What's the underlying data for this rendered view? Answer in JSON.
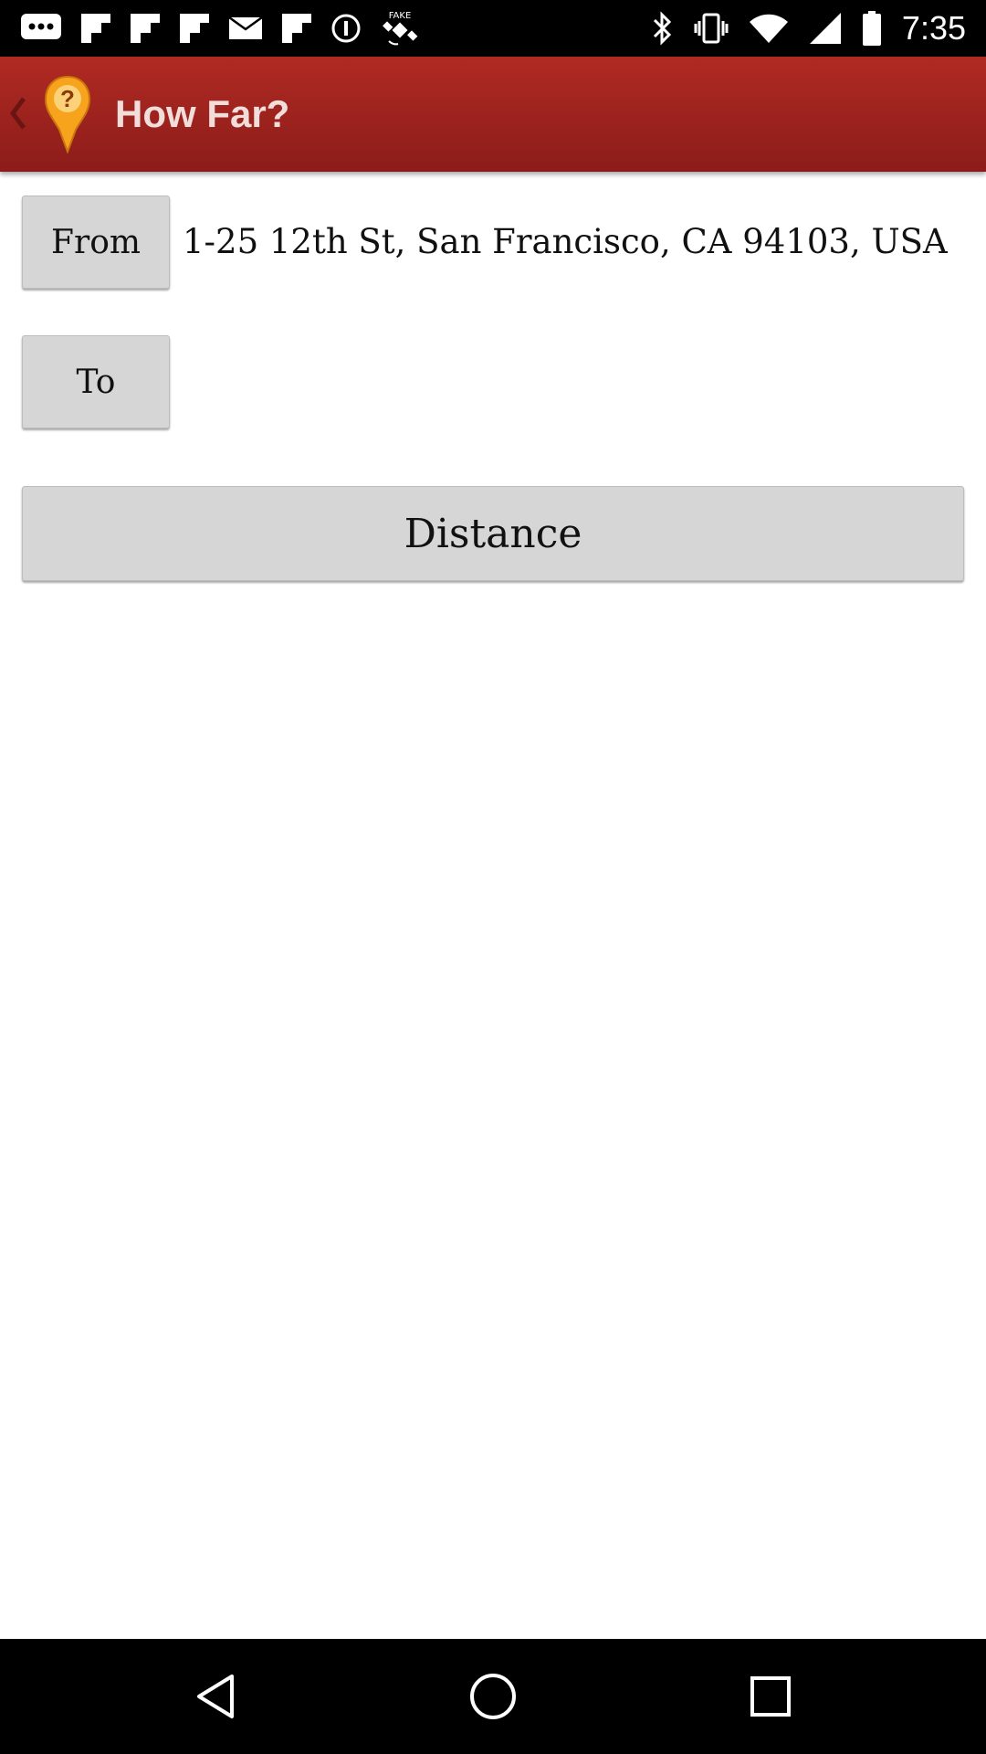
{
  "status_bar": {
    "time": "7:35",
    "left_icons": [
      "messaging-icon",
      "flipboard-icon",
      "flipboard-icon",
      "flipboard-icon",
      "mail-icon",
      "flipboard-icon",
      "info-circle-icon",
      "fake-gps-satellite-icon"
    ],
    "right_icons": [
      "bluetooth-icon",
      "vibrate-icon",
      "wifi-icon",
      "signal-icon",
      "battery-icon"
    ]
  },
  "app_bar": {
    "title": "How Far?",
    "logo_icon": "map-pin-question-icon",
    "back_icon": "chevron-left-icon",
    "colors": {
      "bar_top": "#b02a22",
      "bar_bottom": "#8c1c1a",
      "logo": "#f7a31c"
    }
  },
  "form": {
    "from_label": "From",
    "from_value": "1-25 12th St, San Francisco, CA 94103, USA",
    "to_label": "To",
    "to_value": "",
    "distance_label": "Distance"
  },
  "nav_bar": {
    "items": [
      "back-triangle-icon",
      "home-circle-icon",
      "recents-square-icon"
    ]
  }
}
